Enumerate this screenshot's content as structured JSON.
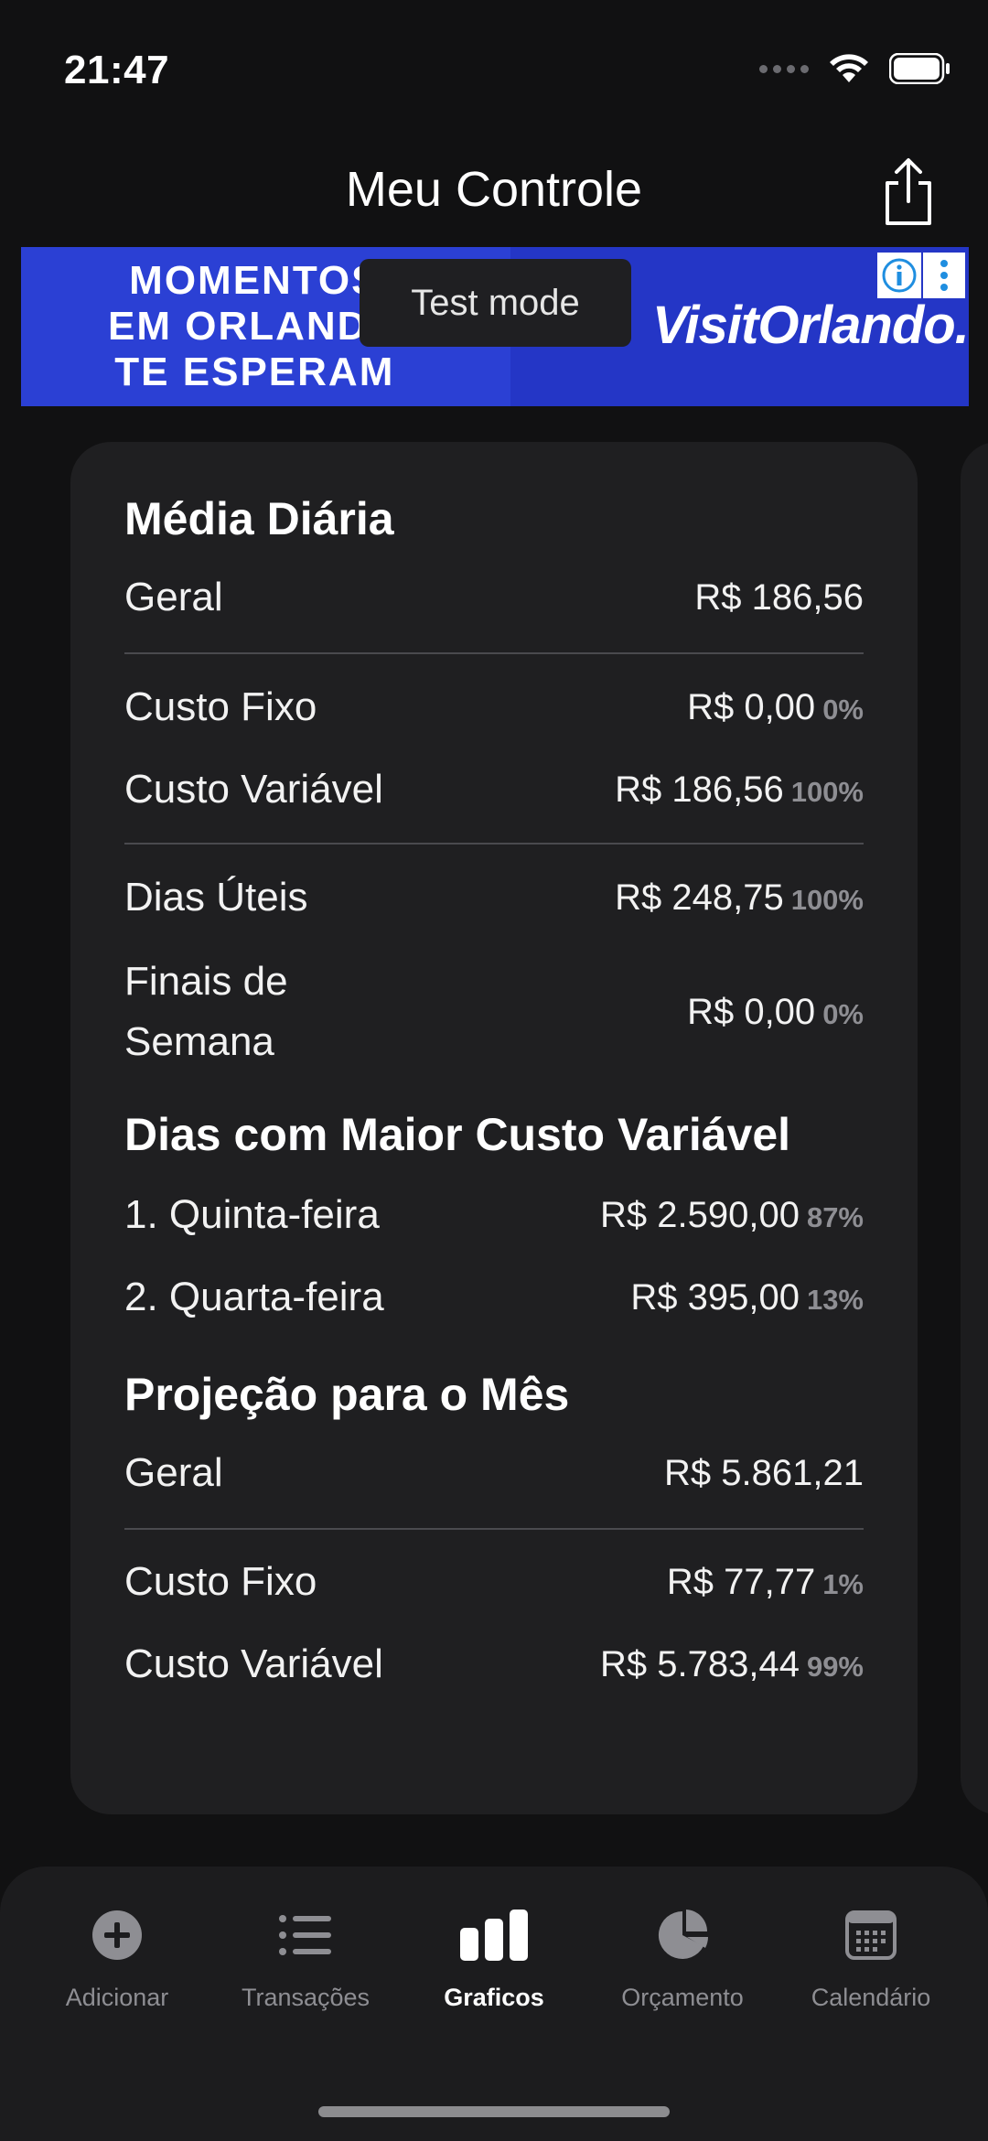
{
  "status": {
    "time": "21:47"
  },
  "header": {
    "title": "Meu Controle"
  },
  "ad": {
    "left_text": "MOMENTOS\nEM ORLANDO\nTE ESPERAM",
    "right_text": "VisitOrlando.",
    "test_mode": "Test mode"
  },
  "daily": {
    "title": "Média Diária",
    "geral": {
      "label": "Geral",
      "value": "R$ 186,56"
    },
    "fixo": {
      "label": "Custo Fixo",
      "value": "R$ 0,00",
      "pct": "0%"
    },
    "variavel": {
      "label": "Custo Variável",
      "value": "R$ 186,56",
      "pct": "100%"
    },
    "uteis": {
      "label": "Dias Úteis",
      "value": "R$ 248,75",
      "pct": "100%"
    },
    "finais": {
      "label": "Finais de Semana",
      "value": "R$ 0,00",
      "pct": "0%"
    }
  },
  "top_days": {
    "title": "Dias com Maior Custo Variável",
    "items": [
      {
        "label": "1. Quinta-feira",
        "value": "R$ 2.590,00",
        "pct": "87%"
      },
      {
        "label": "2. Quarta-feira",
        "value": "R$ 395,00",
        "pct": "13%"
      }
    ]
  },
  "projection": {
    "title": "Projeção para o Mês",
    "geral": {
      "label": "Geral",
      "value": "R$ 5.861,21"
    },
    "fixo": {
      "label": "Custo Fixo",
      "value": "R$ 77,77",
      "pct": "1%"
    },
    "variavel": {
      "label": "Custo Variável",
      "value": "R$ 5.783,44",
      "pct": "99%"
    }
  },
  "tabs": [
    {
      "label": "Adicionar",
      "icon": "plus-circle-icon"
    },
    {
      "label": "Transações",
      "icon": "list-icon"
    },
    {
      "label": "Graficos",
      "icon": "bar-chart-icon",
      "active": true
    },
    {
      "label": "Orçamento",
      "icon": "pie-chart-icon"
    },
    {
      "label": "Calendário",
      "icon": "calendar-icon"
    }
  ],
  "colors": {
    "background": "#111112",
    "card": "#1f1f21",
    "muted": "#8e8e93",
    "ad_blue": "#2b40d4"
  }
}
